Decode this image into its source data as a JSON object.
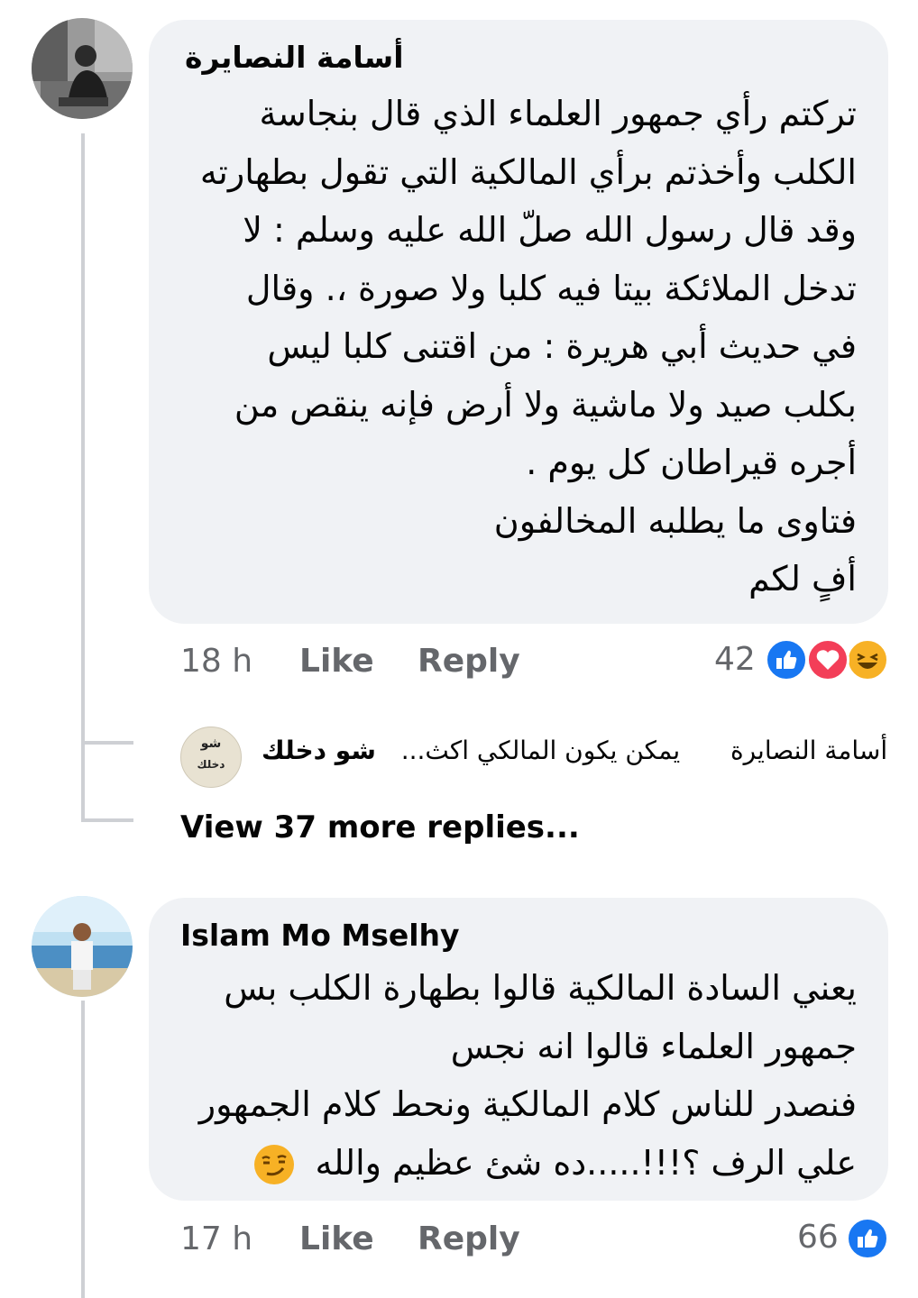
{
  "comments": [
    {
      "author": "أسامة النصايرة",
      "lines": [
        "تركتم رأي جمهور العلماء الذي قال بنجاسة",
        "الكلب وأخذتم برأي المالكية التي تقول بطهارته",
        "وقد قال رسول الله صلّ الله عليه وسلم : لا",
        "تدخل الملائكة بيتا فيه كلبا ولا صورة ،. وقال",
        "في حديث أبي هريرة : من اقتنى كلبا ليس",
        "بكلب صيد ولا ماشية ولا أرض فإنه ينقص من",
        "أجره قيراطان كل يوم .",
        "فتاوى ما يطلبه المخالفون",
        "أفٍ لكم"
      ],
      "time": "18 h",
      "like": "Like",
      "reply": "Reply",
      "reaction_count": "42",
      "reactions": [
        "like-icon",
        "love-icon",
        "haha-icon"
      ]
    },
    {
      "author": "Islam Mo Mselhy",
      "lines": [
        "يعني السادة المالكية قالوا بطهارة الكلب بس",
        "جمهور العلماء قالوا انه نجس",
        "فنصدر للناس كلام المالكية ونحط كلام الجمهور",
        "علي الرف ؟!!!.....ده شئ عظيم والله"
      ],
      "emoji": "smirk-emoji",
      "time": "17 h",
      "like": "Like",
      "reply": "Reply",
      "reaction_count": "66",
      "reactions": [
        "like-icon"
      ]
    }
  ],
  "reply_preview": {
    "avatar_text_top": "شو",
    "avatar_text_bottom": "دخلك",
    "author": "شو دخلك",
    "snippet": "يمكن يكون المالكي اكث...",
    "mention": "أسامة النصايرة"
  },
  "view_more": "View 37 more replies...",
  "colors": {
    "bubble": "#f0f2f5",
    "meta": "#65676b",
    "like_blue": "#1877f2",
    "love_red": "#f33e58",
    "haha_yellow": "#f7b125"
  }
}
